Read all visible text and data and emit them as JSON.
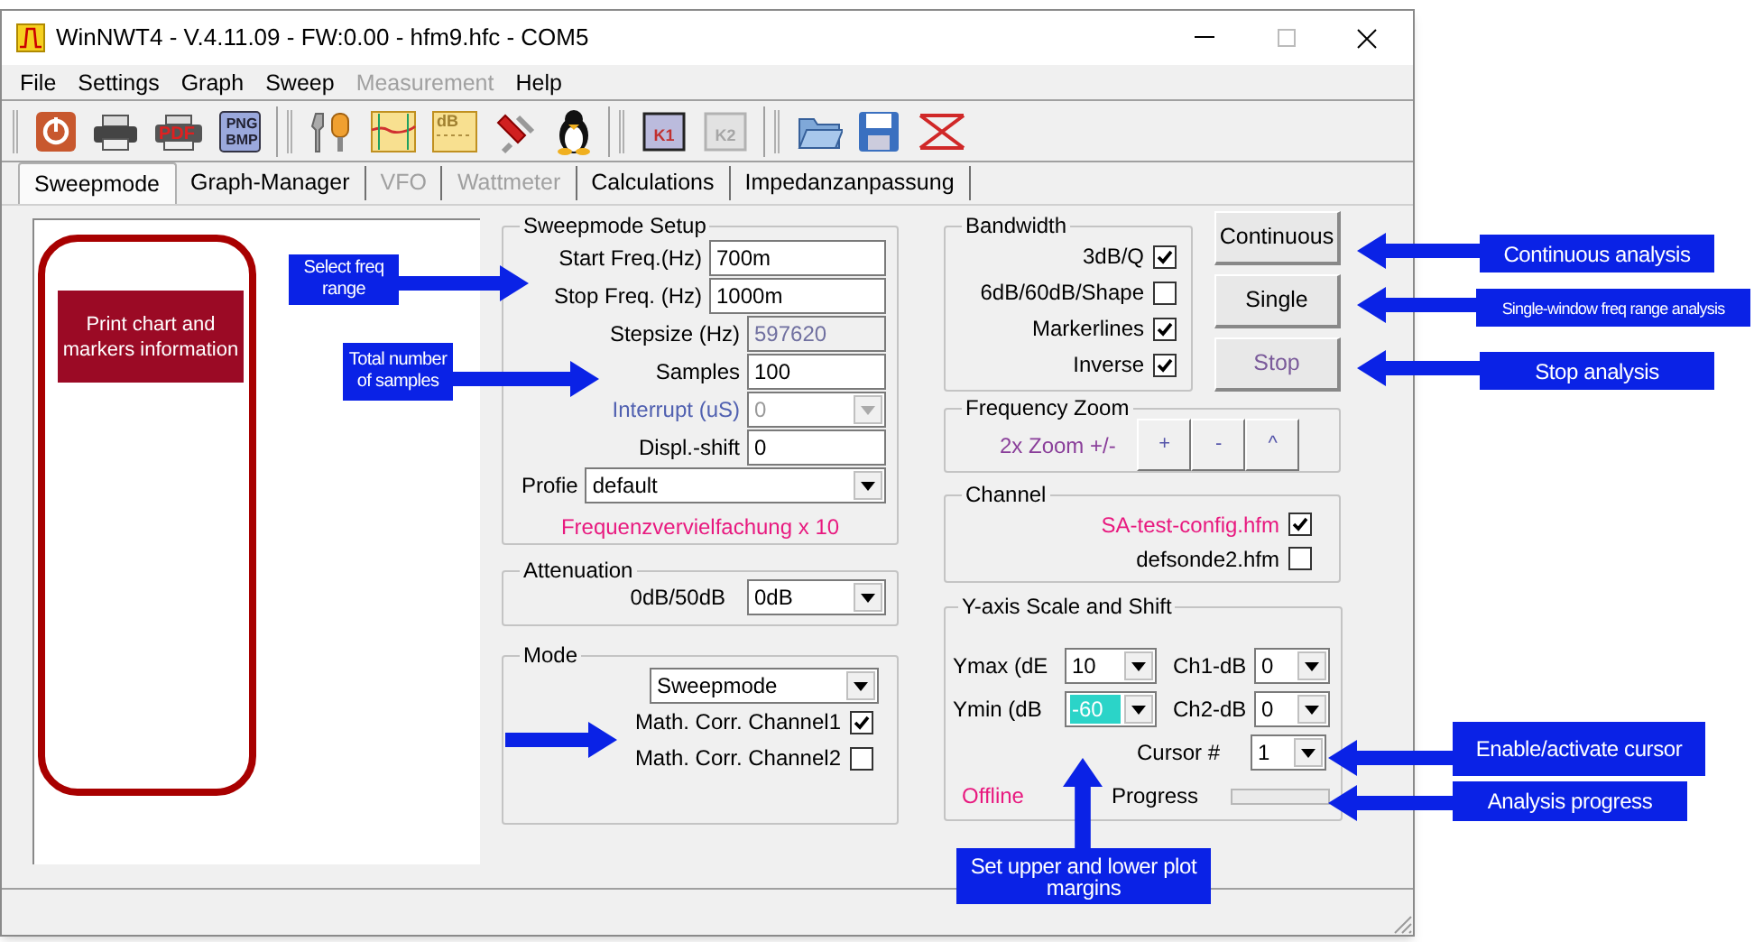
{
  "window": {
    "title": "WinNWT4 - V.4.11.09 - FW:0.00 - hfm9.hfc - COM5"
  },
  "menu": [
    {
      "label": "File",
      "disabled": false
    },
    {
      "label": "Settings",
      "disabled": false
    },
    {
      "label": "Graph",
      "disabled": false
    },
    {
      "label": "Sweep",
      "disabled": false
    },
    {
      "label": "Measurement",
      "disabled": true
    },
    {
      "label": "Help",
      "disabled": false
    }
  ],
  "toolbar": [
    {
      "items": [
        {
          "kind": "power"
        },
        {
          "kind": "printer"
        },
        {
          "kind": "pdf",
          "lines": [
            "PDF"
          ]
        },
        {
          "kind": "image-format",
          "lines": [
            "PNG",
            "BMP"
          ]
        }
      ]
    },
    {
      "items": [
        {
          "kind": "wrench"
        },
        {
          "kind": "chart"
        },
        {
          "kind": "db-chart",
          "lines": [
            "dB"
          ]
        },
        {
          "kind": "tools"
        },
        {
          "kind": "penguin"
        }
      ]
    },
    {
      "items": [
        {
          "kind": "k-chart",
          "lines": [
            "K1"
          ],
          "disabled": false
        },
        {
          "kind": "k-chart",
          "lines": [
            "K2"
          ],
          "disabled": true
        }
      ]
    },
    {
      "items": [
        {
          "kind": "folder"
        },
        {
          "kind": "disk"
        },
        {
          "kind": "resize"
        }
      ]
    }
  ],
  "tabs": [
    {
      "label": "Sweepmode",
      "selected": true,
      "disabled": false
    },
    {
      "label": "Graph-Manager",
      "selected": false,
      "disabled": false
    },
    {
      "label": "VFO",
      "selected": false,
      "disabled": true
    },
    {
      "label": "Wattmeter",
      "selected": false,
      "disabled": true
    },
    {
      "label": "Calculations",
      "selected": false,
      "disabled": false
    },
    {
      "label": "Impedanzanpassung",
      "selected": false,
      "disabled": false
    }
  ],
  "left_panel": {
    "note": "Print chart and markers information"
  },
  "sweep_setup": {
    "title": "Sweepmode Setup",
    "fields": [
      {
        "label": "Start Freq.(Hz)",
        "value": "700m",
        "kind": "input",
        "disabled": false
      },
      {
        "label": "Stop Freq. (Hz)",
        "value": "1000m",
        "kind": "input",
        "disabled": false
      },
      {
        "label": "Stepsize (Hz)",
        "value": "597620",
        "kind": "readonly",
        "disabled": false
      },
      {
        "label": "Samples",
        "value": "100",
        "kind": "input",
        "disabled": false
      },
      {
        "label": "Interrupt (uS)",
        "value": "0",
        "kind": "dropdown",
        "disabled": true
      },
      {
        "label": "Displ.-shift",
        "value": "0",
        "kind": "input",
        "disabled": false
      }
    ],
    "profile": {
      "label": "Profie",
      "value": "default"
    },
    "note": "Frequenzvervielfachung x 10"
  },
  "attenuation": {
    "title": "Attenuation",
    "label": "0dB/50dB",
    "value": "0dB"
  },
  "mode": {
    "title": "Mode",
    "value": "Sweepmode",
    "checks": [
      {
        "label": "Math. Corr. Channel1",
        "checked": true
      },
      {
        "label": "Math. Corr. Channel2",
        "checked": false
      }
    ]
  },
  "bandwidth": {
    "title": "Bandwidth",
    "checks": [
      {
        "label": "3dB/Q",
        "checked": true
      },
      {
        "label": "6dB/60dB/Shape",
        "checked": false
      },
      {
        "label": "Markerlines",
        "checked": true
      },
      {
        "label": "Inverse",
        "checked": true
      }
    ]
  },
  "buttons": [
    {
      "label": "Continuous",
      "disabled": false
    },
    {
      "label": "Single",
      "disabled": false
    },
    {
      "label": "Stop",
      "disabled": true
    }
  ],
  "frequency_zoom": {
    "title": "Frequency Zoom",
    "label": "2x Zoom +/-",
    "buttons": [
      "+",
      "-",
      "^"
    ]
  },
  "channel": {
    "title": "Channel",
    "checks": [
      {
        "label": "SA-test-config.hfm",
        "checked": true,
        "color": "#e8197f"
      },
      {
        "label": "defsonde2.hfm",
        "checked": false,
        "color": "#000000"
      }
    ]
  },
  "y_axis": {
    "title": "Y-axis Scale and Shift",
    "controls": [
      {
        "label": "Ymax (dE",
        "value": "10",
        "selected": false
      },
      {
        "label": "Ch1-dB",
        "value": "0",
        "selected": false
      },
      {
        "label": "Ymin (dB",
        "value": "-60",
        "selected": true
      },
      {
        "label": "Ch2-dB",
        "value": "0",
        "selected": false
      },
      {
        "label": "Cursor #",
        "value": "1",
        "selected": false
      }
    ],
    "status": "Offline",
    "progress_label": "Progress",
    "progress": {
      "level": 0
    }
  },
  "annotations": [
    {
      "text": "Select freq range",
      "kind": "right"
    },
    {
      "text": "Total number of samples",
      "kind": "right"
    },
    {
      "kind": "right"
    },
    {
      "text": "Continuous analysis",
      "kind": "left"
    },
    {
      "text": "Single-window freq range analysis",
      "kind": "left"
    },
    {
      "text": "Stop analysis",
      "kind": "left"
    },
    {
      "text": "Enable/activate cursor",
      "kind": "left"
    },
    {
      "text": "Analysis progress",
      "kind": "left"
    },
    {
      "text": "Set upper and lower plot margins",
      "kind": "up"
    }
  ]
}
